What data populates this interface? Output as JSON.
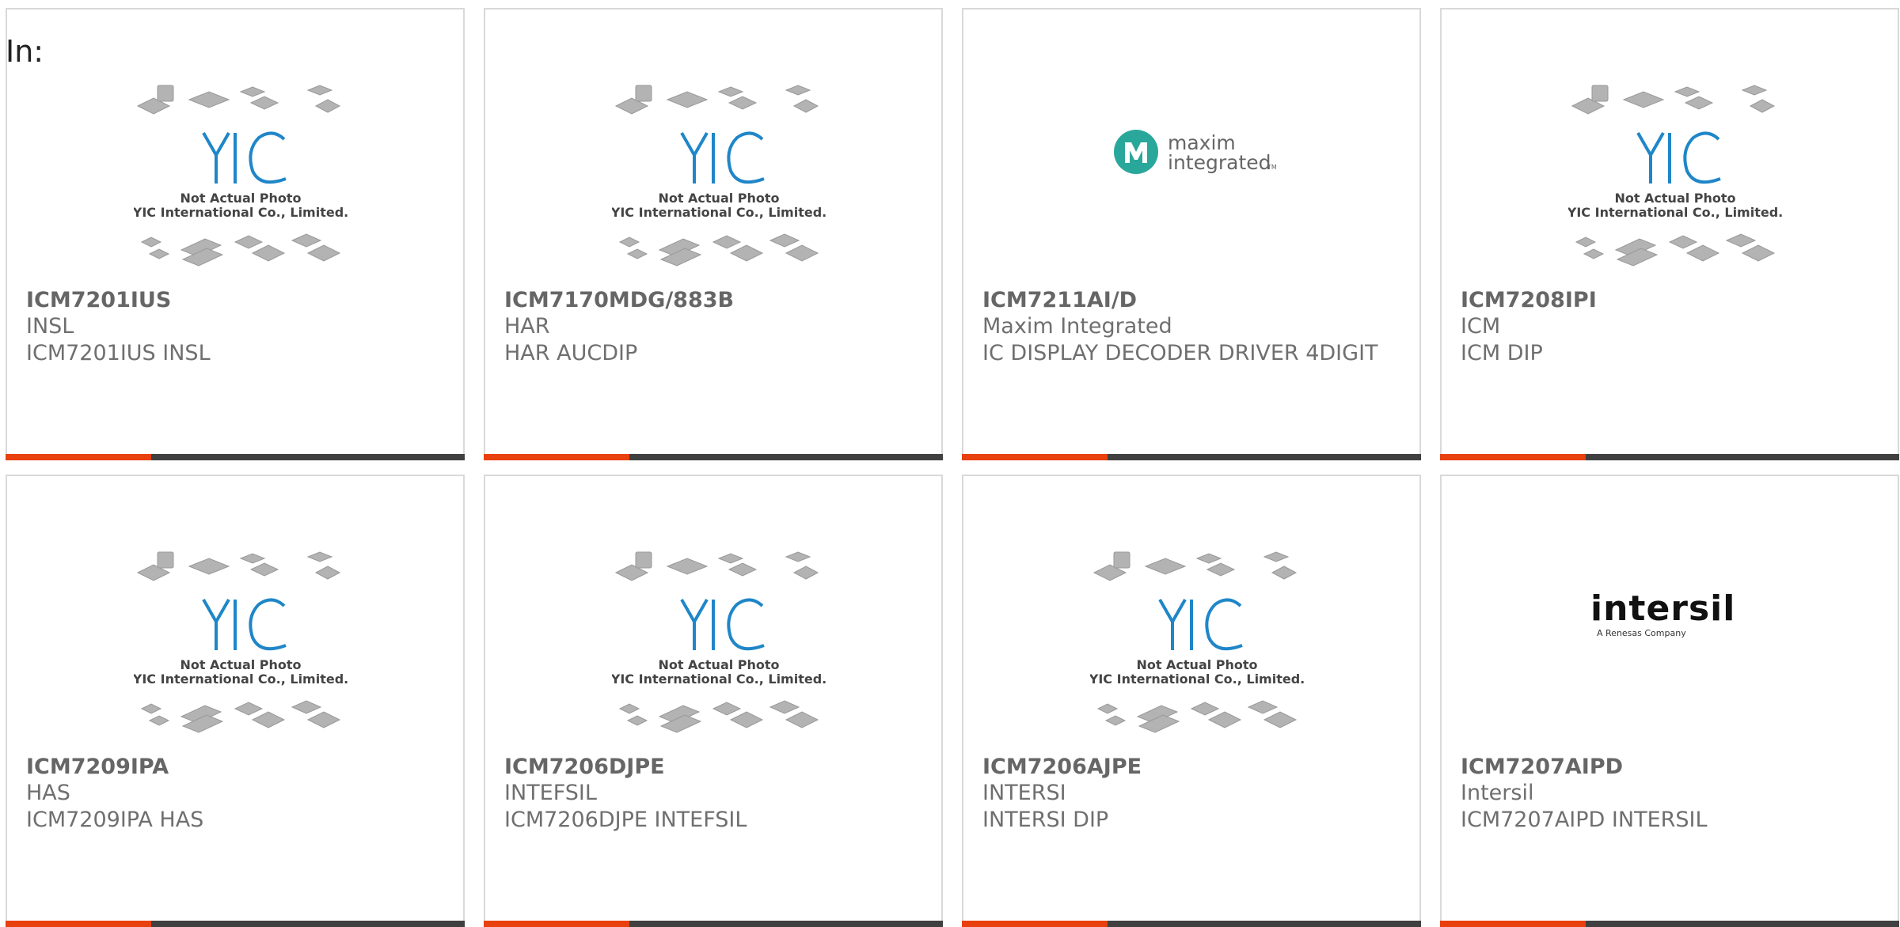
{
  "header": {
    "label": "In:"
  },
  "placeholder": {
    "line1": "Not Actual Photo",
    "line2": "YIC International Co., Limited.",
    "logo_text": "YIC"
  },
  "logos": {
    "maxim": {
      "line1": "maxim",
      "line2": "integrated",
      "tm": "TM"
    },
    "intersil": {
      "name": "intersil",
      "sub": "A Renesas Company"
    }
  },
  "colors": {
    "accent": "#e8400e",
    "bar": "#404040",
    "yic_blue": "#1f86c8",
    "maxim_teal": "#2aa79b"
  },
  "products": [
    {
      "part": "ICM7201IUS",
      "maker": "INSL",
      "desc": "ICM7201IUS INSL",
      "image": "placeholder"
    },
    {
      "part": "ICM7170MDG/883B",
      "maker": "HAR",
      "desc": "HAR AUCDIP",
      "image": "placeholder"
    },
    {
      "part": "ICM7211AI/D",
      "maker": "Maxim Integrated",
      "desc": "IC DISPLAY DECODER DRIVER 4DIGIT",
      "image": "maxim-logo"
    },
    {
      "part": "ICM7208IPI",
      "maker": "ICM",
      "desc": "ICM DIP",
      "image": "placeholder"
    },
    {
      "part": "ICM7209IPA",
      "maker": "HAS",
      "desc": "ICM7209IPA HAS",
      "image": "placeholder"
    },
    {
      "part": "ICM7206DJPE",
      "maker": "INTEFSIL",
      "desc": "ICM7206DJPE INTEFSIL",
      "image": "placeholder"
    },
    {
      "part": "ICM7206AJPE",
      "maker": "INTERSI",
      "desc": "INTERSI DIP",
      "image": "placeholder"
    },
    {
      "part": "ICM7207AIPD",
      "maker": "Intersil",
      "desc": "ICM7207AIPD INTERSIL",
      "image": "intersil-logo"
    }
  ]
}
